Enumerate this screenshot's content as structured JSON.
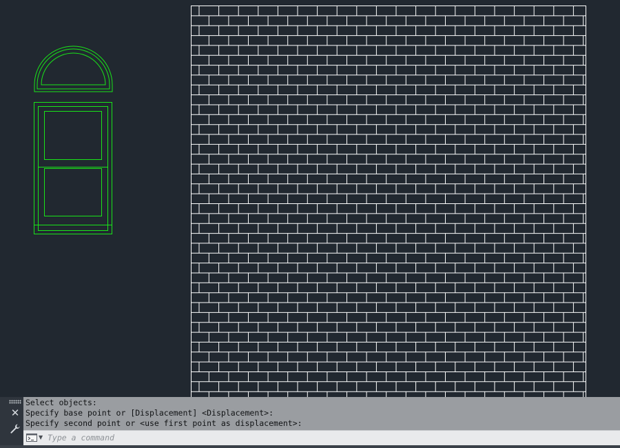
{
  "canvas": {
    "background": "#212830",
    "window_color": "#19e619",
    "brick_color": "#ffffff",
    "objects": [
      {
        "type": "arched-transom-window",
        "icon": "half-round-window"
      },
      {
        "type": "double-hung-window",
        "icon": "rectangular-window"
      },
      {
        "type": "brick-hatch-wall",
        "icon": "brick-pattern"
      }
    ]
  },
  "command_line": {
    "history": [
      "Select objects:",
      "Specify base point or [Displacement] <Displacement>:",
      "Specify second point or <use first point as displacement>:"
    ],
    "input_value": "",
    "input_placeholder": "Type a command",
    "icons": {
      "grip": "grip-dots-icon",
      "close": "close-icon",
      "customize": "wrench-icon",
      "prompt": "command-prompt-icon",
      "dropdown": "chevron-down-icon"
    },
    "close_glyph": "✕",
    "dropdown_glyph": "▼"
  }
}
